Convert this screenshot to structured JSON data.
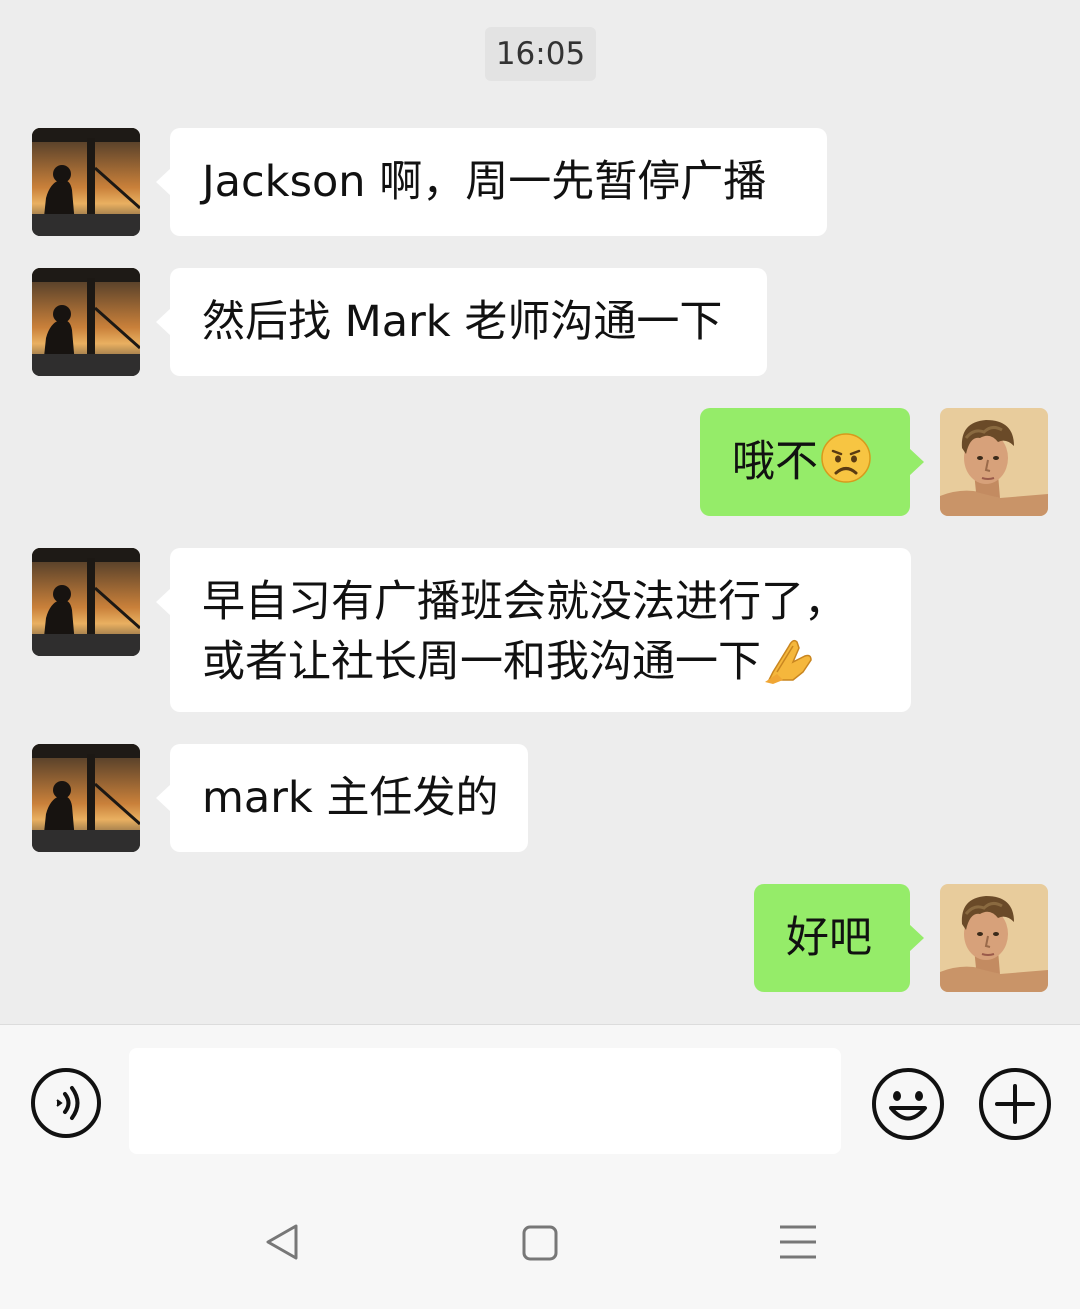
{
  "timestamp": "16:05",
  "messages": [
    {
      "side": "incoming",
      "text": "Jackson 啊，周一先暂停广播"
    },
    {
      "side": "incoming",
      "text": "然后找 Mark 老师沟通一下"
    },
    {
      "side": "outgoing",
      "text": "哦不",
      "emoji": "disappointed-face-emoji"
    },
    {
      "side": "incoming",
      "line1": "早自习有广播班会就没法进行了，",
      "line2": "或者让社长周一和我沟通一下",
      "emoji": "pray-hands-emoji"
    },
    {
      "side": "incoming",
      "text": "mark 主任发的"
    },
    {
      "side": "outgoing",
      "text": "好吧"
    }
  ],
  "input_bar": {
    "placeholder": "",
    "icons": [
      "voice-icon",
      "emoji-icon",
      "plus-icon"
    ]
  },
  "nav_bar": {
    "icons": [
      "back-icon",
      "home-icon",
      "menu-icon"
    ]
  },
  "colors": {
    "background": "#ededed",
    "incoming_bubble": "#ffffff",
    "outgoing_bubble": "#95ec69"
  }
}
